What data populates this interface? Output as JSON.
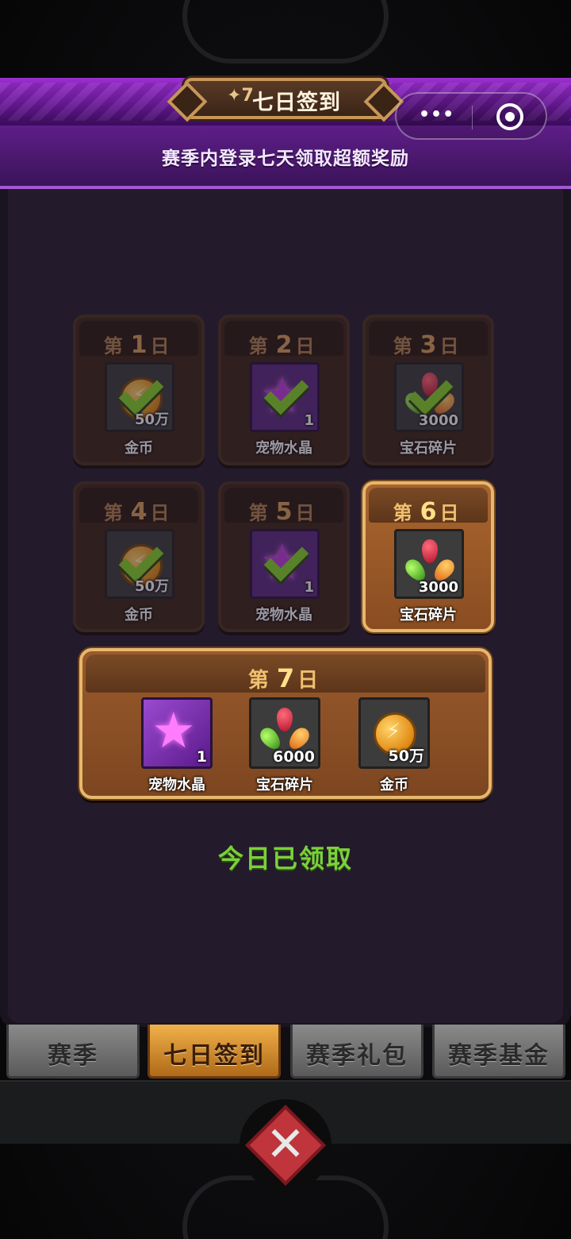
{
  "header": {
    "badge": "7",
    "title": "七日签到",
    "subtitle": "赛季内登录七天领取超额奖励"
  },
  "capsule": {
    "more_icon": "more-dots-icon",
    "target_icon": "target-icon"
  },
  "days": [
    {
      "day_prefix": "第",
      "day_num": "1",
      "day_suffix": "日",
      "item": "金币",
      "qty": "50万",
      "icon": "coin-icon",
      "claimed": true
    },
    {
      "day_prefix": "第",
      "day_num": "2",
      "day_suffix": "日",
      "item": "宠物水晶",
      "qty": "1",
      "icon": "star-crystal-icon",
      "claimed": true
    },
    {
      "day_prefix": "第",
      "day_num": "3",
      "day_suffix": "日",
      "item": "宝石碎片",
      "qty": "3000",
      "icon": "gem-shards-icon",
      "claimed": true
    },
    {
      "day_prefix": "第",
      "day_num": "4",
      "day_suffix": "日",
      "item": "金币",
      "qty": "50万",
      "icon": "coin-icon",
      "claimed": true
    },
    {
      "day_prefix": "第",
      "day_num": "5",
      "day_suffix": "日",
      "item": "宠物水晶",
      "qty": "1",
      "icon": "star-crystal-icon",
      "claimed": true
    },
    {
      "day_prefix": "第",
      "day_num": "6",
      "day_suffix": "日",
      "item": "宝石碎片",
      "qty": "3000",
      "icon": "gem-shards-icon",
      "claimed": false
    }
  ],
  "day7": {
    "day_prefix": "第",
    "day_num": "7",
    "day_suffix": "日",
    "rewards": [
      {
        "item": "宠物水晶",
        "qty": "1",
        "icon": "star-crystal-icon"
      },
      {
        "item": "宝石碎片",
        "qty": "6000",
        "icon": "gem-shards-icon"
      },
      {
        "item": "金币",
        "qty": "50万",
        "icon": "coin-icon"
      }
    ]
  },
  "status": "今日已领取",
  "tabs": [
    {
      "label": "赛季",
      "active": false
    },
    {
      "label": "七日签到",
      "active": true
    },
    {
      "label": "赛季礼包",
      "active": false
    },
    {
      "label": "赛季基金",
      "active": false
    }
  ],
  "close_icon": "close-x-icon",
  "colors": {
    "accent_purple": "#9b2fd0",
    "claimed_green": "#7ad13a",
    "active_tab": "#f0b04a"
  }
}
